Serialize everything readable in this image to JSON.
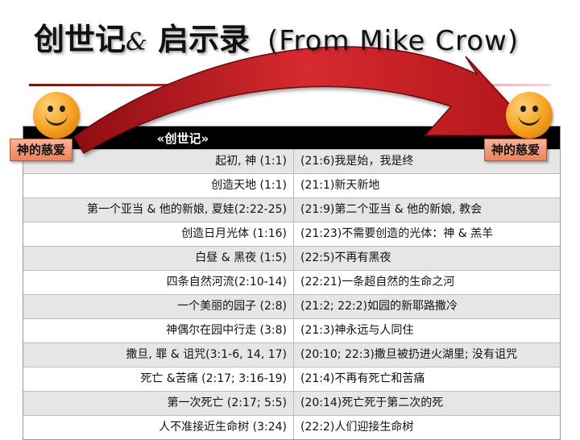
{
  "title": {
    "main": "创世记",
    "amp": "&",
    "second": "启示录",
    "credit": "(From Mike Crow)"
  },
  "badges": {
    "left": "神的慈爱",
    "right": "神的慈爱"
  },
  "table": {
    "header_left": "«创世记»",
    "rows": [
      {
        "left": "起初, 神 (1:1)",
        "right": "(21:6)我是始，我是终"
      },
      {
        "left": "创造天地 (1:1)",
        "right": "(21:1)新天新地"
      },
      {
        "left": "第一个亚当 & 他的新娘, 夏娃(2:22-25)",
        "right": "(21:9)第二个亚当 & 他的新娘, 教会"
      },
      {
        "left": "创造日月光体 (1:16)",
        "right": "(21:23)不需要创造的光体：神 & 羔羊"
      },
      {
        "left": "白昼 & 黑夜 (1:5)",
        "right": "(22:5)不再有黑夜"
      },
      {
        "left": "四条自然河流(2:10-14)",
        "right": "(22:21)一条超自然的生命之河"
      },
      {
        "left": "一个美丽的园子 (2:8)",
        "right": "(21:2; 22:2)如园的新耶路撒冷"
      },
      {
        "left": "神偶尔在园中行走 (3:8)",
        "right": "(21:3)神永远与人同住"
      },
      {
        "left": "撒旦, 罪 & 诅咒(3:1-6, 14, 17)",
        "right": "(20:10; 22:3)撒旦被扔进火湖里; 没有诅咒"
      },
      {
        "left": "死亡 &苦痛 (2:17; 3:16-19)",
        "right": "(21:4)不再有死亡和苦痛"
      },
      {
        "left": "第一次死亡 (2:17; 5:5)",
        "right": "(20:14)死亡死于第二次的死"
      },
      {
        "left": "人不准接近生命树 (3:24)",
        "right": "(22:2)人们迎接生命树"
      }
    ]
  },
  "colors": {
    "arrow": "#c0141c",
    "header_bg": "#000000",
    "row_alt": "#e6e6e6",
    "badge": "#e9835c",
    "smiley": "#f5a01e"
  },
  "icons": {
    "left": "smiley-face-icon",
    "right": "smiley-face-icon",
    "arrow": "curved-arrow-icon"
  }
}
